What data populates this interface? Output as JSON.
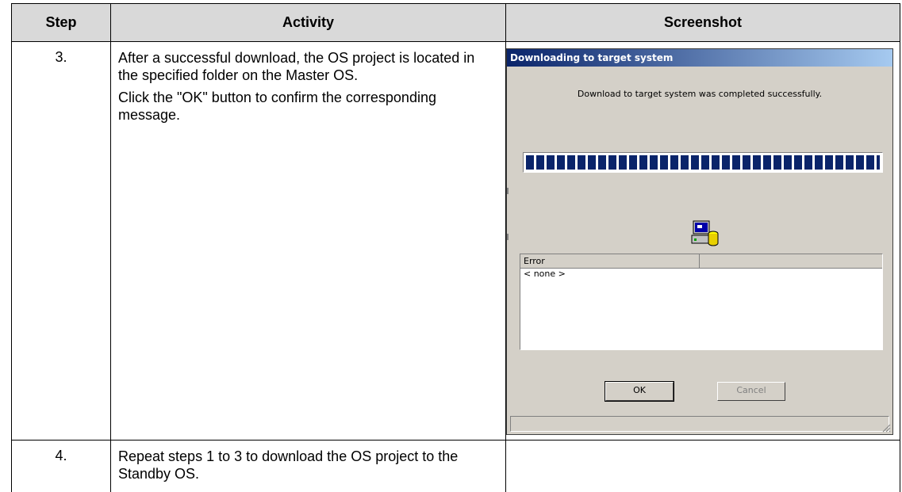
{
  "table": {
    "headers": [
      "Step",
      "Activity",
      "Screenshot"
    ],
    "rows": [
      {
        "step": "3.",
        "activity": [
          "After a successful download, the OS project is located in the specified folder on the Master OS.",
          "Click the \"OK\" button to confirm the corresponding message."
        ]
      },
      {
        "step": "4.",
        "activity": [
          "Repeat steps 1 to 3 to download the OS project to the Standby OS."
        ]
      }
    ]
  },
  "dialog": {
    "title": "Downloading to target system",
    "message": "Download to target system was completed successfully.",
    "progress": 1.0,
    "list_header": "Error",
    "list_rows": [
      "< none >"
    ],
    "ok_label": "OK",
    "cancel_label": "Cancel",
    "icon": "computer-database-icon"
  }
}
